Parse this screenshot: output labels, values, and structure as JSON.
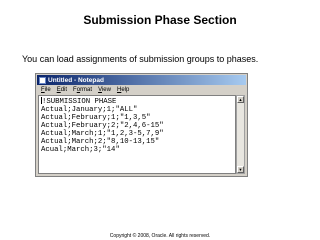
{
  "slide": {
    "title": "Submission Phase Section",
    "text": "You can load assignments of submission groups to phases.",
    "footer": "Copyright © 2008, Oracle. All rights reserved."
  },
  "notepad": {
    "title": "Untitled - Notepad",
    "icon": "notepad-icon",
    "menu": [
      {
        "acc": "F",
        "rest": "ile"
      },
      {
        "acc": "E",
        "rest": "dit"
      },
      {
        "pre": "F",
        "acc": "o",
        "rest": "rmat"
      },
      {
        "acc": "V",
        "rest": "iew"
      },
      {
        "acc": "H",
        "rest": "elp"
      }
    ],
    "lines": [
      "!SUBMISSION PHASE",
      "Actual;January;1;\"ALL\"",
      "Actual;February;1;\"1,3,5\"",
      "Actual;February;2;\"2,4,6-15\"",
      "Actual;March;1;\"1,2,3-5,7,9\"",
      "Actual;March;2;\"8,10-13,15\"",
      "Acual;March;3;\"14\""
    ]
  },
  "colors": {
    "titlebar_start": "#0a246a",
    "titlebar_end": "#a6caf0",
    "window_face": "#d4d0c8"
  }
}
